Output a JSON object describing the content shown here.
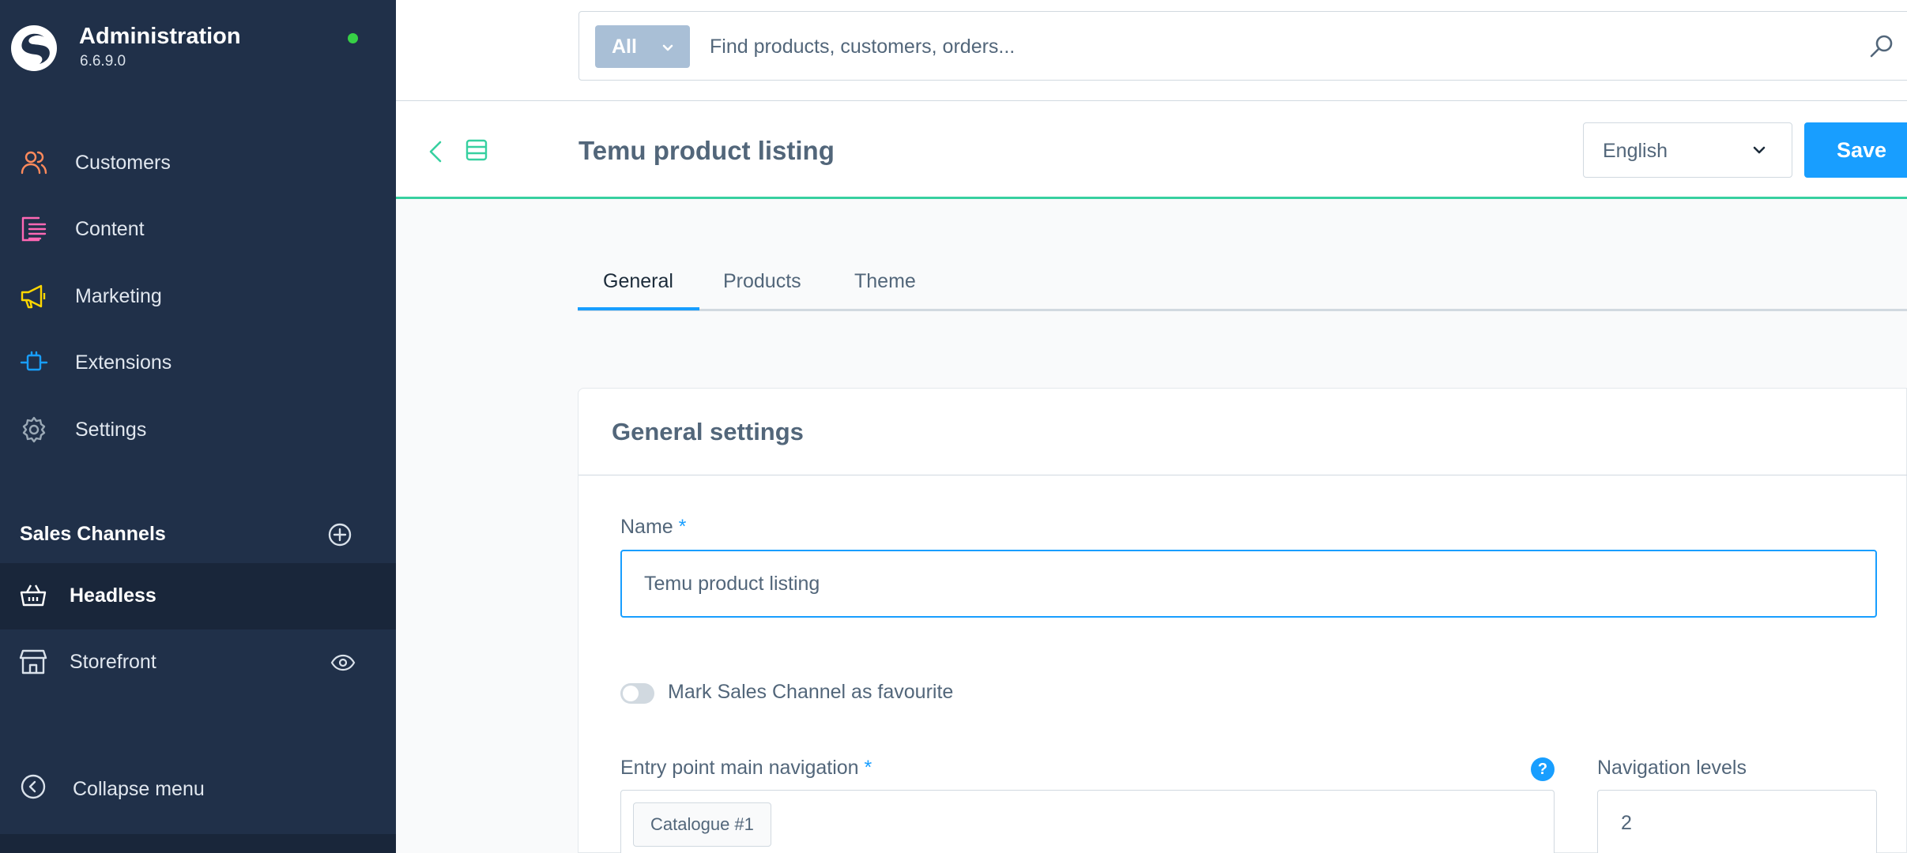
{
  "app": {
    "title": "Administration",
    "version": "6.6.9.0",
    "status_color": "#37d046"
  },
  "sidebar": {
    "items": [
      {
        "label": "Customers",
        "icon": "customers-icon",
        "color": "#ff8a5c"
      },
      {
        "label": "Content",
        "icon": "content-icon",
        "color": "#ff68b4"
      },
      {
        "label": "Marketing",
        "icon": "marketing-icon",
        "color": "#ffd700"
      },
      {
        "label": "Extensions",
        "icon": "extensions-icon",
        "color": "#189eff"
      },
      {
        "label": "Settings",
        "icon": "settings-icon",
        "color": "#9aa8b5"
      }
    ],
    "sales_channels_title": "Sales Channels",
    "sales_channels": [
      {
        "label": "Headless",
        "icon": "basket-icon",
        "active": true
      },
      {
        "label": "Storefront",
        "icon": "storefront-icon",
        "active": false
      }
    ],
    "collapse_label": "Collapse menu"
  },
  "search": {
    "type_label": "All",
    "placeholder": "Find products, customers, orders..."
  },
  "header": {
    "title": "Temu product listing",
    "language": "English",
    "save_label": "Save"
  },
  "tabs": [
    {
      "label": "General",
      "active": true
    },
    {
      "label": "Products",
      "active": false
    },
    {
      "label": "Theme",
      "active": false
    }
  ],
  "card": {
    "title": "General settings",
    "name_label": "Name",
    "required_mark": "*",
    "name_value": "Temu product listing",
    "favourite_label": "Mark Sales Channel as favourite",
    "favourite_on": false,
    "entry_label": "Entry point main navigation",
    "entry_chip": "Catalogue #1",
    "help_mark": "?",
    "levels_label": "Navigation levels",
    "levels_value": "2"
  },
  "colors": {
    "sidebar_bg": "#203049",
    "accent": "#189eff",
    "header_border": "#37d0a0"
  }
}
